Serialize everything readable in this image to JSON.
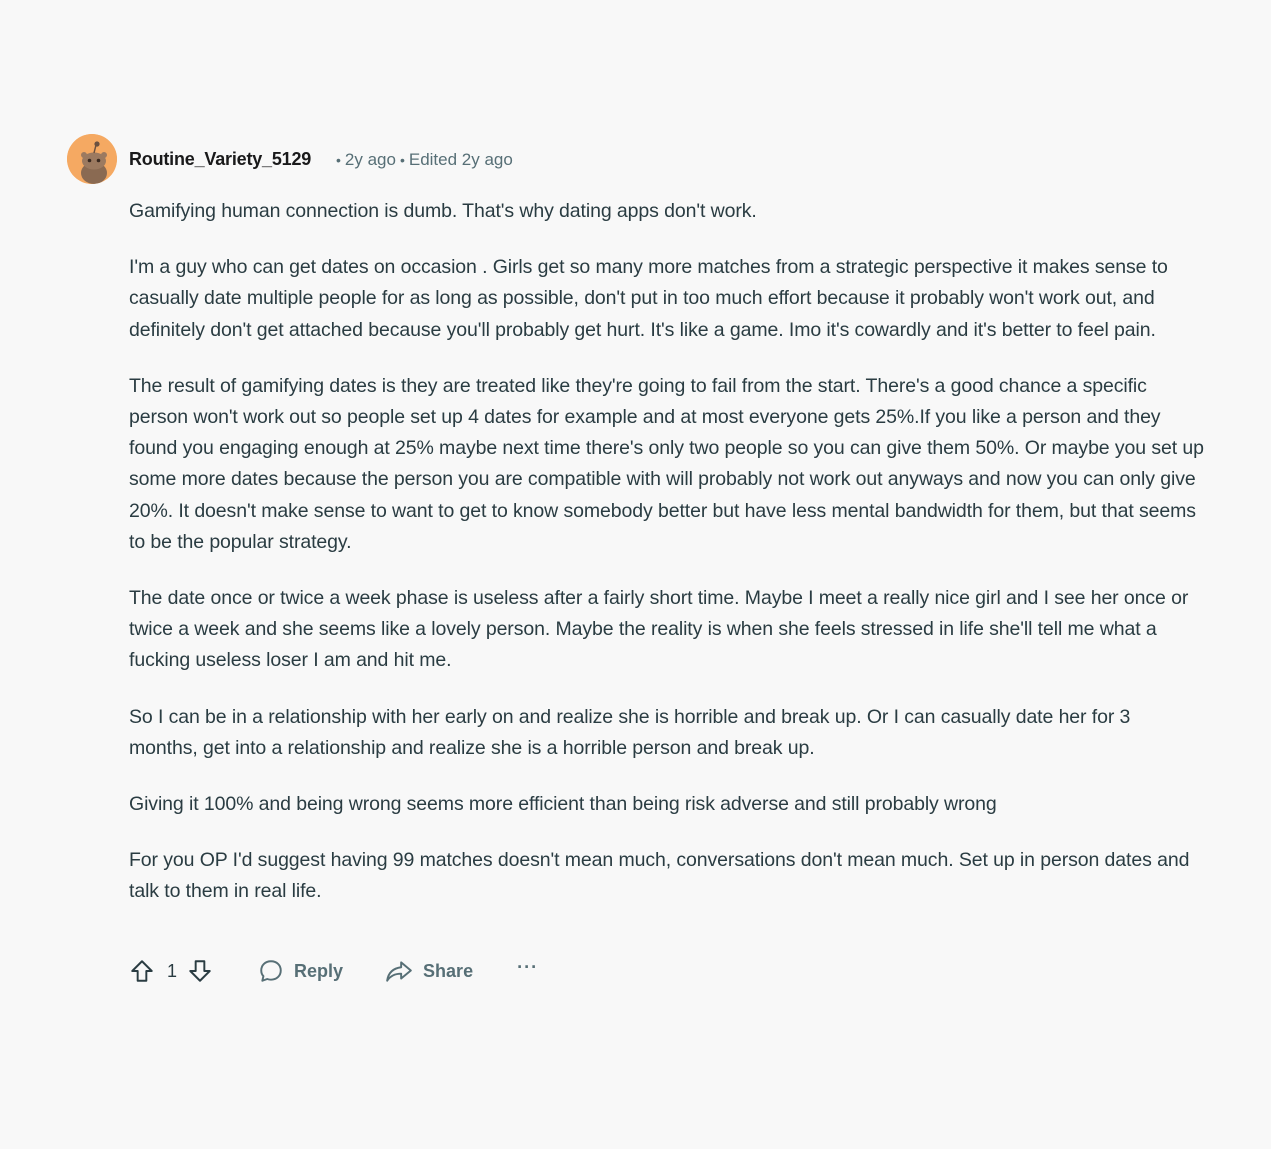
{
  "comment": {
    "author": "Routine_Variety_5129",
    "posted": "2y ago",
    "edited": "Edited 2y ago",
    "paragraphs": [
      "Gamifying human connection is dumb. That's why dating apps don't work.",
      "I'm a guy who can get dates on occasion . Girls get so many more matches from a strategic perspective it makes sense to casually date multiple people for as long as possible, don't put in too much effort because it probably won't work out, and definitely don't get attached because you'll probably get hurt. It's like a game. Imo it's cowardly and it's better to feel pain.",
      "The result of gamifying dates is they are treated like they're going to fail from the start. There's a good chance a specific person won't work out so people set up 4 dates for example and at most everyone gets 25%.If you like a person and they found you engaging enough at 25% maybe next time there's only two people so you can give them 50%. Or maybe you set up some more dates because the person you are compatible with will probably not work out anyways and now you can only give 20%. It doesn't make sense to want to get to know somebody better but have less mental bandwidth for them, but that seems to be the popular strategy.",
      "The date once or twice a week phase is useless after a fairly short time. Maybe I meet a really nice girl and I see her once or twice a week and she seems like a lovely person. Maybe the reality is when she feels stressed in life she'll tell me what a fucking useless loser I am and hit me.",
      "So I can be in a relationship with her early on and realize she is horrible and break up. Or I can casually date her for 3 months, get into a relationship and realize she is a horrible person and break up.",
      "Giving it 100% and being wrong seems more efficient than being risk adverse and still probably wrong",
      "For you OP I'd suggest having 99 matches doesn't mean much, conversations don't mean much. Set up in person dates and talk to them in real life."
    ],
    "actions": {
      "vote_count": "1",
      "reply_label": "Reply",
      "share_label": "Share",
      "more_label": "···"
    }
  },
  "icons": {
    "avatar": "snoo-avatar",
    "upvote": "upvote-arrow-icon",
    "downvote": "downvote-arrow-icon",
    "reply": "speech-bubble-icon",
    "share": "share-arrow-icon"
  },
  "colors": {
    "background": "#f8f8f8",
    "avatar": "#f5a962",
    "text": "#2a3c42",
    "meta": "#576f76"
  }
}
